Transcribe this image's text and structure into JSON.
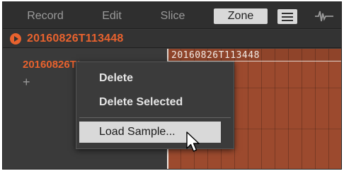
{
  "tabs": {
    "record": "Record",
    "edit": "Edit",
    "slice": "Slice",
    "zone": "Zone"
  },
  "sample": {
    "title": "20160826T113448",
    "list_item": "20160826T113448",
    "zone_name": "20160826T113448"
  },
  "context_menu": {
    "items": [
      "Delete",
      "Delete Selected",
      "Load Sample..."
    ],
    "highlighted": "Load Sample..."
  },
  "colors": {
    "accent": "#e8622e",
    "zone_fill": "#9c4a2e",
    "panel": "#3a3a3a",
    "selected_tab": "#d9d9d9"
  },
  "icons": [
    "hamburger-menu-icon",
    "waveform-icon",
    "play-icon",
    "add-icon",
    "mouse-cursor-icon"
  ]
}
